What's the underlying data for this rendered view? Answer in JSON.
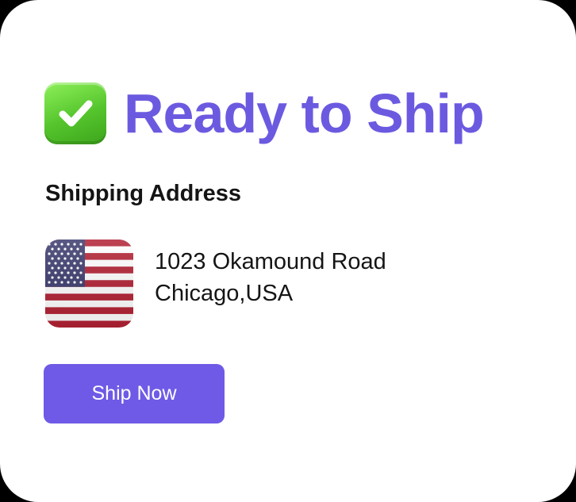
{
  "status": {
    "icon": "check-mark-icon",
    "title": "Ready to Ship"
  },
  "shipping": {
    "heading": "Shipping Address",
    "flag_icon": "us-flag-icon",
    "address_line1": "1023 Okamound Road",
    "address_line2": "Chicago,USA"
  },
  "actions": {
    "ship_now_label": "Ship Now"
  },
  "colors": {
    "accent": "#6b5ae0",
    "button": "#6e5ae6",
    "check_green": "#54c42c",
    "text": "#151515"
  }
}
